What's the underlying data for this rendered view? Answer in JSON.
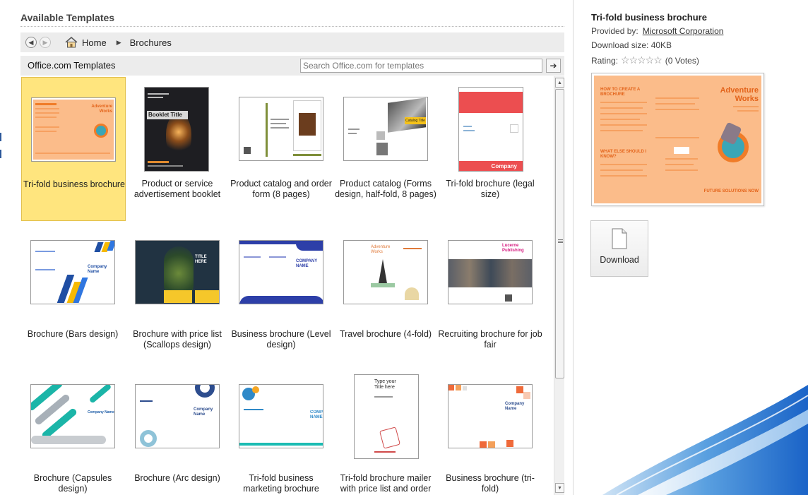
{
  "left_panel": {
    "title": "Available Templates",
    "nav": {
      "back_label": "◀",
      "forward_label": "▶",
      "home_label": "Home",
      "separator": "▶",
      "current": "Brochures"
    },
    "source_bar": {
      "label": "Office.com Templates",
      "search_placeholder": "Search Office.com for templates",
      "go_label": "➔"
    }
  },
  "templates": [
    {
      "name": "Tri-fold business brochure",
      "selected": true
    },
    {
      "name": "Product or service advertisement booklet"
    },
    {
      "name": "Product catalog and order form (8 pages)"
    },
    {
      "name": "Product catalog (Forms design, half-fold, 8 pages)"
    },
    {
      "name": "Tri-fold brochure (legal size)"
    },
    {
      "name": "Brochure (Bars design)"
    },
    {
      "name": "Brochure with price list (Scallops design)"
    },
    {
      "name": "Business brochure (Level design)"
    },
    {
      "name": "Travel brochure (4-fold)"
    },
    {
      "name": "Recruiting brochure for job fair"
    },
    {
      "name": "Brochure (Capsules design)"
    },
    {
      "name": "Brochure (Arc design)"
    },
    {
      "name": "Tri-fold business marketing brochure"
    },
    {
      "name": "Tri-fold brochure mailer with price list and order form"
    },
    {
      "name": "Business brochure (tri-fold)"
    }
  ],
  "thumb_text": {
    "t1_heading": "Adventure Works",
    "t2_booklet": "Booklet Title",
    "t5_company": "Company",
    "t6_company": "Company Name",
    "t8_company": "COMPANY NAME",
    "t9_travel": "Adventure Works",
    "t10_lucerne": "Lucerne Publishing",
    "t11_company": "Company Name",
    "t12_company": "Company Name",
    "t13_company": "COMPANY NAME",
    "t14_type": "Type your Title here",
    "t15_company": "Company Name",
    "t7_title": "TITLE HERE",
    "t4_catalog": "Catalog Title"
  },
  "details": {
    "title": "Tri-fold business brochure",
    "provided_by_label": "Provided by:",
    "provider": "Microsoft Corporation",
    "download_size": "Download size: 40KB",
    "rating_label": "Rating:",
    "stars": "☆☆☆☆☆",
    "votes": "(0 Votes)",
    "download_label": "Download",
    "preview_heading": "HOW TO CREATE A BROCHURE",
    "preview_brand": "Adventure Works",
    "preview_sub": "WHAT ELSE SHOULD I KNOW?",
    "preview_footer": "FUTURE SOLUTIONS NOW"
  },
  "colors": {
    "selected_bg": "#ffe57e",
    "brochure_peach": "#fbbc8a",
    "brochure_orange": "#f07c28"
  }
}
